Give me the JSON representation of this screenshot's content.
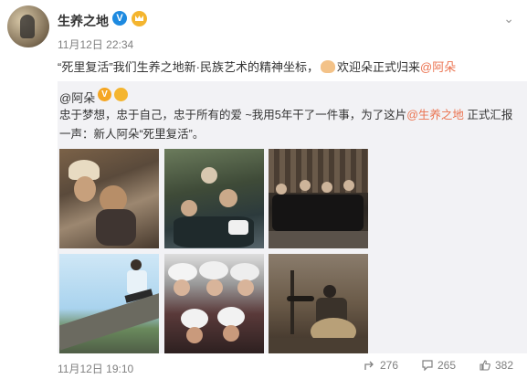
{
  "post": {
    "author": "生养之地",
    "verified_mark": "V",
    "timestamp": "11月12日 22:34",
    "text_before": "“死里复活”我们生养之地新·民族艺术的精神坐标，",
    "text_middle": "欢迎朵正式归来",
    "mention": "@阿朵"
  },
  "repost": {
    "author": "@阿朵",
    "text_line_before": "忠于梦想，忠于自己，忠于所有的爱 ~我用5年干了一件事，为了这片",
    "mention": "@生养之地",
    "text_line_after": " 正式汇报一声：新人阿朵“死里复活”。",
    "footer_time": "11月12日 19:10",
    "reposts": "276",
    "comments": "265",
    "likes": "382"
  },
  "icons": {
    "chevron": "chevron-down-icon",
    "repost": "share-arrow-icon",
    "comment": "comment-bubble-icon",
    "like": "thumbs-up-icon"
  },
  "colors": {
    "link": "#eb7350",
    "repost_background": "#f2f2f5",
    "verified_blue": "#1d8ae0",
    "crown_gold": "#f4b52f"
  }
}
